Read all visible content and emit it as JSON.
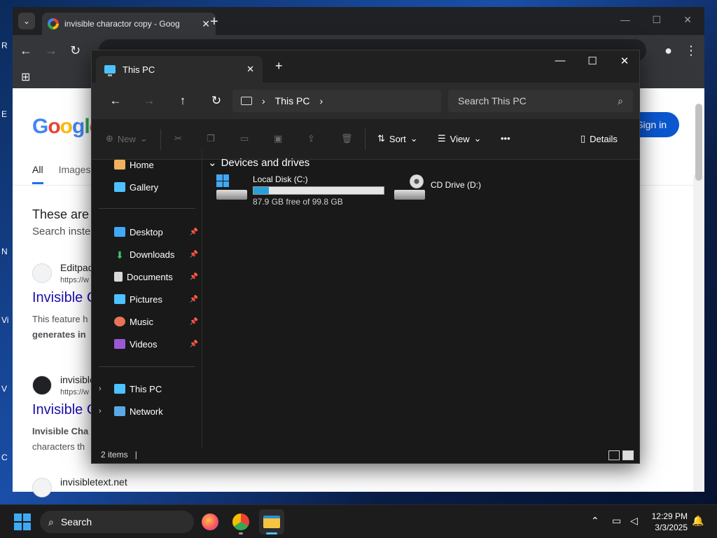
{
  "desktop": {
    "icon_labels": [
      "R",
      "E",
      "N",
      "Vi",
      "V",
      "C"
    ]
  },
  "chrome": {
    "tab_title": "invisible charactor copy - Goog",
    "google": {
      "logo": "Google",
      "signin": "Sign in",
      "tabs": [
        "All",
        "Images"
      ],
      "heading_line1": "These are",
      "heading_line2": "Search inste",
      "results": [
        {
          "site": "Editpad",
          "url": "https://w",
          "title": "Invisible C",
          "snippet1": "This feature h",
          "snippet2": "generates in"
        },
        {
          "site": "invisible",
          "url": "https://w",
          "title": "Invisible C",
          "snippet1": "Invisible Cha",
          "snippet2": "characters th"
        },
        {
          "site": "invisibletext.net",
          "url": "",
          "title": "",
          "snippet1": "",
          "snippet2": ""
        }
      ]
    }
  },
  "explorer": {
    "tab_title": "This PC",
    "breadcrumb": "This PC",
    "search_placeholder": "Search This PC",
    "commands": {
      "new": "New",
      "sort": "Sort",
      "view": "View",
      "more": "•••",
      "details": "Details"
    },
    "nav": {
      "home": "Home",
      "gallery": "Gallery",
      "pinned": [
        "Desktop",
        "Downloads",
        "Documents",
        "Pictures",
        "Music",
        "Videos"
      ],
      "this_pc": "This PC",
      "network": "Network"
    },
    "group_header": "Devices and drives",
    "drives": [
      {
        "name": "Local Disk (C:)",
        "free": "87.9 GB free of 99.8 GB",
        "used_fraction": 0.119
      },
      {
        "name": "CD Drive (D:)"
      }
    ],
    "status": "2 items"
  },
  "taskbar": {
    "search_label": "Search",
    "time": "12:29 PM",
    "date": "3/3/2025"
  },
  "colors": {
    "accent": "#4cc2ff",
    "usage": "#26a0da"
  }
}
